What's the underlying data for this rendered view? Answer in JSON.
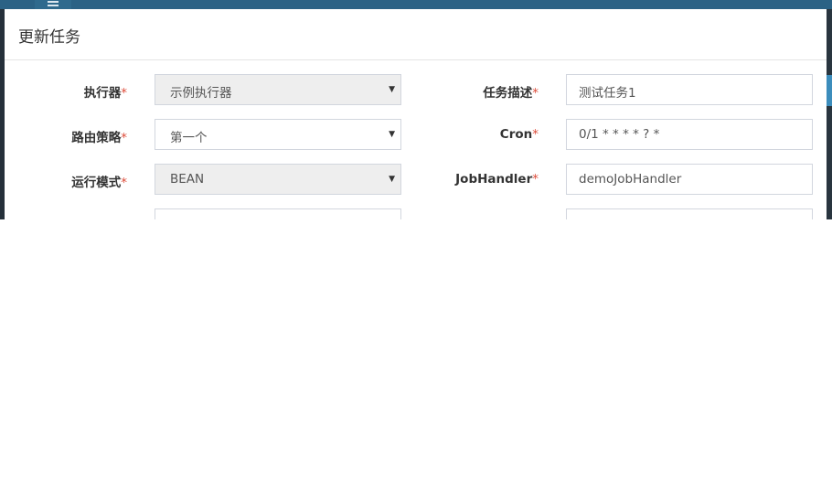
{
  "dialog": {
    "title": "更新任务"
  },
  "form": {
    "required_mark": "*",
    "executor": {
      "label": "执行器",
      "value": "示例执行器",
      "disabled": true
    },
    "task_desc": {
      "label": "任务描述",
      "value": "测试任务1"
    },
    "route_strategy": {
      "label": "路由策略",
      "value": "第一个"
    },
    "cron": {
      "label": "Cron",
      "value": "0/1 * * * * ? *"
    },
    "run_mode": {
      "label": "运行模式",
      "value": "BEAN",
      "disabled": true
    },
    "job_handler": {
      "label": "JobHandler",
      "value": "demoJobHandler"
    }
  },
  "colors": {
    "header_bar": "#2b6285",
    "required_star": "#dd4b39",
    "disabled_field": "#eeeeee",
    "field_border": "#d2d6de"
  },
  "icons": {
    "menu_toggle": "hamburger-icon",
    "select_caret": "caret-down-icon"
  }
}
